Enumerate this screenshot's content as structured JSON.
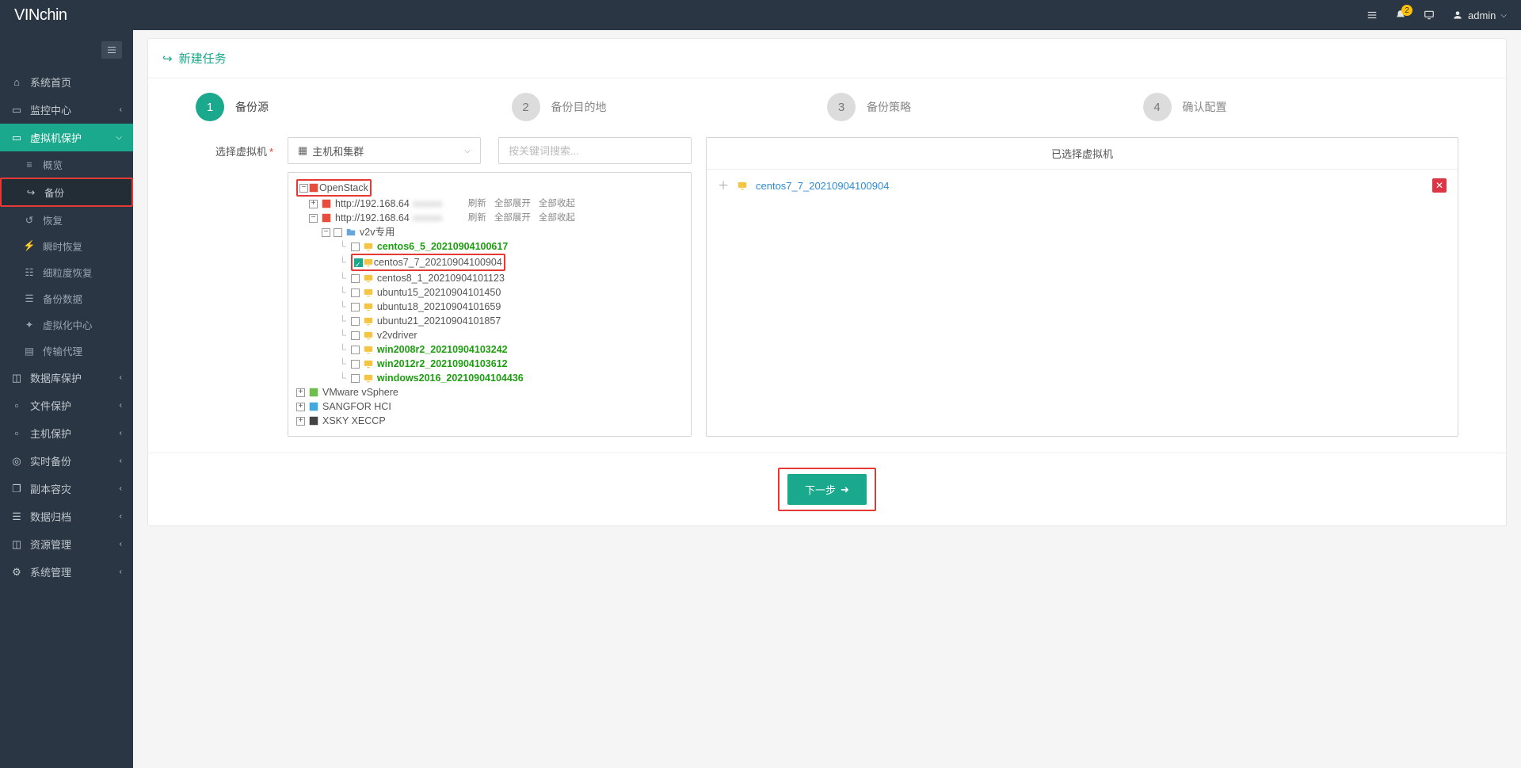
{
  "brand": {
    "part1": "VIN",
    "part2": "chin"
  },
  "header": {
    "notif_count": "2",
    "user": "admin"
  },
  "sidebar": {
    "items": [
      {
        "icon": "home",
        "label": "系统首页",
        "expand": false
      },
      {
        "icon": "monitor",
        "label": "监控中心",
        "expand": true
      },
      {
        "icon": "monitor",
        "label": "虚拟机保护",
        "expand": true,
        "active": true
      },
      {
        "icon": "db",
        "label": "数据库保护",
        "expand": true
      },
      {
        "icon": "file",
        "label": "文件保护",
        "expand": true
      },
      {
        "icon": "host",
        "label": "主机保护",
        "expand": true
      },
      {
        "icon": "shield",
        "label": "实时备份",
        "expand": true
      },
      {
        "icon": "copy",
        "label": "副本容灾",
        "expand": true
      },
      {
        "icon": "archive",
        "label": "数据归档",
        "expand": true
      },
      {
        "icon": "res",
        "label": "资源管理",
        "expand": true
      },
      {
        "icon": "gear",
        "label": "系统管理",
        "expand": true
      }
    ],
    "sub": [
      {
        "icon": "list",
        "label": "概览"
      },
      {
        "icon": "share",
        "label": "备份",
        "selected": true,
        "highlight": true
      },
      {
        "icon": "restore",
        "label": "恢复"
      },
      {
        "icon": "flash",
        "label": "瞬时恢复"
      },
      {
        "icon": "grain",
        "label": "细粒度恢复"
      },
      {
        "icon": "data",
        "label": "备份数据"
      },
      {
        "icon": "virt",
        "label": "虚拟化中心"
      },
      {
        "icon": "agent",
        "label": "传输代理"
      }
    ]
  },
  "panel": {
    "title": "新建任务"
  },
  "wizard": [
    {
      "num": "1",
      "label": "备份源",
      "current": true
    },
    {
      "num": "2",
      "label": "备份目的地"
    },
    {
      "num": "3",
      "label": "备份策略"
    },
    {
      "num": "4",
      "label": "确认配置"
    }
  ],
  "form": {
    "select_label": "选择虚拟机",
    "dropdown_value": "主机和集群",
    "search_placeholder": "按关键词搜索..."
  },
  "tree": {
    "root_openstack": "OpenStack",
    "host1_prefix": "http://192.168.64",
    "host2_prefix": "http://192.168.64",
    "actions": {
      "refresh": "刷新",
      "expand_all": "全部展开",
      "collapse_all": "全部收起"
    },
    "folder_v2v": "v2v专用",
    "vms": [
      {
        "name": "centos6_5_20210904100617",
        "bold": true
      },
      {
        "name": "centos7_7_20210904100904",
        "bold": false,
        "checked": true,
        "highlight": true
      },
      {
        "name": "centos8_1_20210904101123",
        "bold": false
      },
      {
        "name": "ubuntu15_20210904101450",
        "bold": false
      },
      {
        "name": "ubuntu18_20210904101659",
        "bold": false
      },
      {
        "name": "ubuntu21_20210904101857",
        "bold": false
      },
      {
        "name": "v2vdriver",
        "bold": false
      },
      {
        "name": "win2008r2_20210904103242",
        "bold": true
      },
      {
        "name": "win2012r2_20210904103612",
        "bold": true
      },
      {
        "name": "windows2016_20210904104436",
        "bold": true
      }
    ],
    "vendors": [
      {
        "name": "VMware vSphere"
      },
      {
        "name": "SANGFOR HCI"
      },
      {
        "name": "XSKY XECCP"
      }
    ]
  },
  "selected": {
    "title": "已选择虚拟机",
    "items": [
      {
        "name": "centos7_7_20210904100904"
      }
    ]
  },
  "footer": {
    "next": "下一步"
  }
}
